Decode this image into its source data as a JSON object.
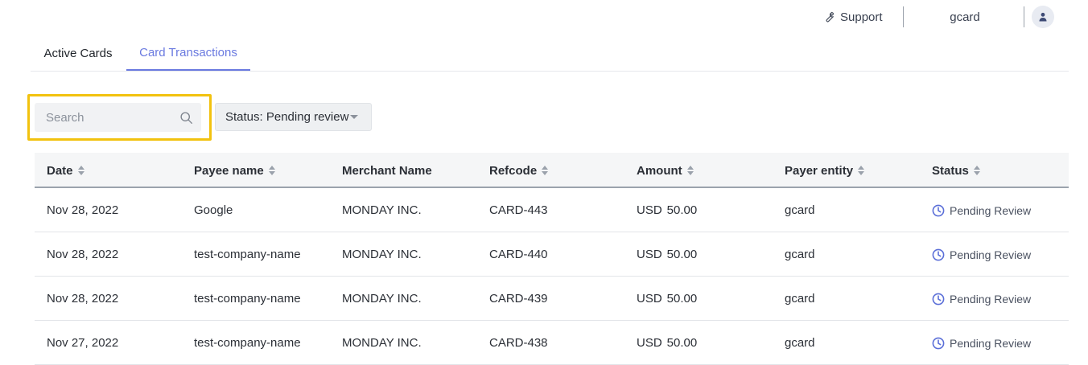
{
  "header": {
    "support_label": "Support",
    "username": "gcard"
  },
  "tabs": [
    {
      "label": "Active Cards"
    },
    {
      "label": "Card Transactions"
    }
  ],
  "search": {
    "placeholder": "Search",
    "value": ""
  },
  "filter": {
    "status_label": "Status: Pending review"
  },
  "table": {
    "columns": [
      "Date",
      "Payee name",
      "Merchant Name",
      "Refcode",
      "Amount",
      "Payer entity",
      "Status"
    ],
    "rows": [
      {
        "date": "Nov 28, 2022",
        "payee": "Google",
        "merchant": "MONDAY INC.",
        "refcode": "CARD-443",
        "currency": "USD",
        "amount": "50.00",
        "payer": "gcard",
        "status": "Pending Review"
      },
      {
        "date": "Nov 28, 2022",
        "payee": "test-company-name",
        "merchant": "MONDAY INC.",
        "refcode": "CARD-440",
        "currency": "USD",
        "amount": "50.00",
        "payer": "gcard",
        "status": "Pending Review"
      },
      {
        "date": "Nov 28, 2022",
        "payee": "test-company-name",
        "merchant": "MONDAY INC.",
        "refcode": "CARD-439",
        "currency": "USD",
        "amount": "50.00",
        "payer": "gcard",
        "status": "Pending Review"
      },
      {
        "date": "Nov 27, 2022",
        "payee": "test-company-name",
        "merchant": "MONDAY INC.",
        "refcode": "CARD-438",
        "currency": "USD",
        "amount": "50.00",
        "payer": "gcard",
        "status": "Pending Review"
      }
    ]
  },
  "colors": {
    "accent": "#6a7ae0",
    "status_icon": "#5b6fd8",
    "highlight": "#f2c20f"
  },
  "icons": {
    "support": "wrench-icon",
    "avatar": "user-icon",
    "search": "search-icon",
    "sort": "sort-icon",
    "status": "clock-icon"
  }
}
